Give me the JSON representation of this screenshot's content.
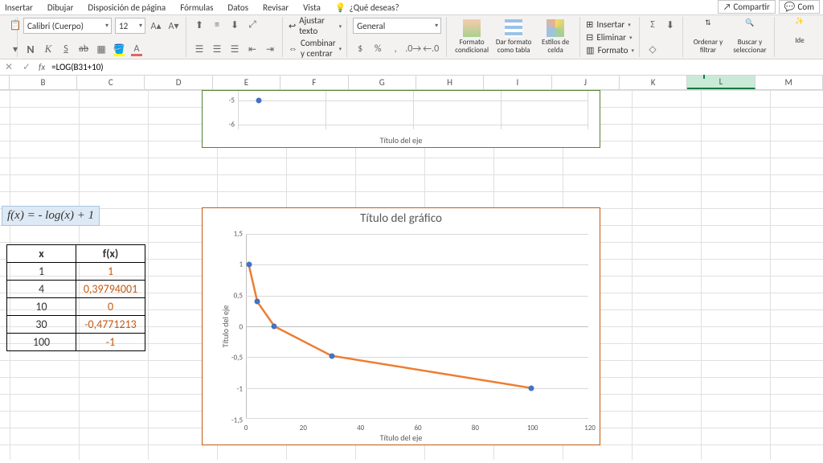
{
  "menu": {
    "items": [
      "Insertar",
      "Dibujar",
      "Disposición de página",
      "Fórmulas",
      "Datos",
      "Revisar",
      "Vista"
    ],
    "help": "¿Qué deseas?",
    "share": "Compartir",
    "comments": "Com"
  },
  "ribbon": {
    "font_name": "Calibri (Cuerpo)",
    "font_size": "12",
    "wrap": "Ajustar texto",
    "merge": "Combinar y centrar",
    "number_format": "General",
    "cond_fmt": "Formato condicional",
    "as_table": "Dar formato como tabla",
    "cell_styles": "Estilos de celda",
    "insert": "Insertar",
    "delete": "Eliminar",
    "format": "Formato",
    "sort": "Ordenar y filtrar",
    "find": "Buscar y seleccionar",
    "ideas": "Ide"
  },
  "formula": "=LOG(B31+10)",
  "columns": [
    "B",
    "C",
    "D",
    "E",
    "F",
    "G",
    "H",
    "I",
    "J",
    "K",
    "L",
    "M"
  ],
  "selected_col": "L",
  "formula_tag": "f(x) = - log(x)  + 1",
  "table": {
    "headers": [
      "x",
      "f(x)"
    ],
    "rows": [
      [
        "1",
        "1"
      ],
      [
        "4",
        "0,39794001"
      ],
      [
        "10",
        "0"
      ],
      [
        "30",
        "-0,4771213"
      ],
      [
        "100",
        "-1"
      ]
    ]
  },
  "chart_top": {
    "axis_title": "Título del eje",
    "y_ticks": [
      "-5",
      "-6"
    ]
  },
  "chart_main": {
    "title": "Título del gráfico",
    "axis_title_x": "Título del eje",
    "axis_title_y": "Título del eje",
    "x_ticks": [
      "0",
      "20",
      "40",
      "60",
      "80",
      "100",
      "120"
    ],
    "y_ticks": [
      "1,5",
      "1",
      "0,5",
      "0",
      "-0,5",
      "-1",
      "-1,5"
    ]
  },
  "chart_data": [
    {
      "type": "line",
      "title": "Título del gráfico",
      "xlabel": "Título del eje",
      "ylabel": "Título del eje",
      "xlim": [
        0,
        120
      ],
      "ylim": [
        -1.5,
        1.5
      ],
      "series": [
        {
          "name": "f(x)",
          "x": [
            1,
            4,
            10,
            30,
            100
          ],
          "y": [
            1,
            0.398,
            0,
            -0.477,
            -1
          ]
        }
      ]
    },
    {
      "type": "line",
      "note": "partially visible top chart",
      "xlabel": "Título del eje",
      "visible_y_ticks": [
        -5,
        -6
      ]
    }
  ]
}
